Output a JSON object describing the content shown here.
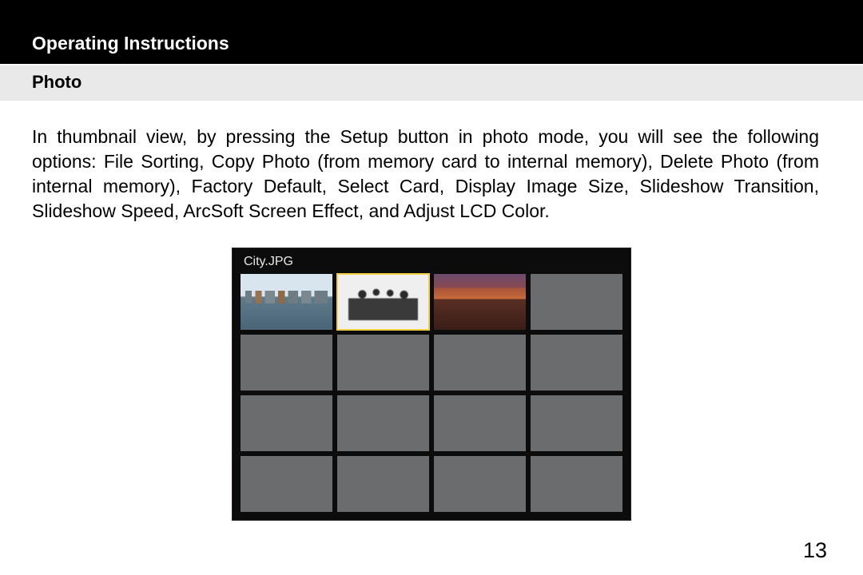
{
  "header": {
    "title": "Operating Instructions"
  },
  "section": {
    "title": "Photo"
  },
  "paragraph": "In thumbnail view, by pressing the Setup button in photo mode, you will see the following options: File Sorting, Copy Photo (from memory card to internal memory), Delete Photo (from internal memory), Factory Default, Select Card, Display Image Size, Slideshow Transition, Slideshow Speed, ArcSoft Screen Effect, and Adjust LCD Color.",
  "frame": {
    "filename": "City.JPG",
    "grid_rows": 4,
    "grid_cols": 4,
    "selected_index": 1,
    "thumbnails": [
      {
        "type": "city"
      },
      {
        "type": "dancers"
      },
      {
        "type": "canyon"
      }
    ]
  },
  "page_number": "13"
}
